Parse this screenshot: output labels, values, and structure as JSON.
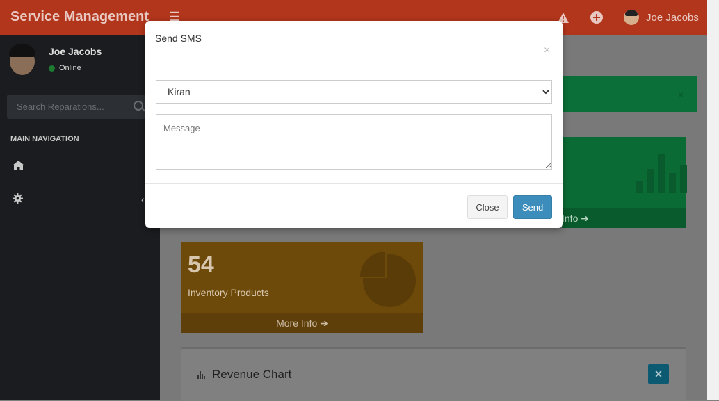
{
  "header": {
    "brand": "Service Management",
    "user_name": "Joe Jacobs",
    "icons": [
      "bars-icon",
      "warning-icon",
      "plus-circle-icon",
      "avatar"
    ]
  },
  "sidebar": {
    "user_name": "Joe Jacobs",
    "status": "Online",
    "search_placeholder": "Search Reparations...",
    "nav_header": "MAIN NAVIGATION",
    "nav_icons": [
      "home-icon",
      "gear-icon"
    ]
  },
  "dashboard": {
    "green_box_footer": "Info",
    "inventory": {
      "count": "54",
      "label": "Inventory Products",
      "footer": "More Info"
    },
    "revenue_card_title": "Revenue Chart"
  },
  "modal": {
    "title": "Send SMS",
    "close_icon": "×",
    "recipient_selected": "Kiran",
    "message_placeholder": "Message",
    "close_button": "Close",
    "send_button": "Send"
  },
  "colors": {
    "header": "#b2361c",
    "sidebar": "#1a1c1f",
    "green_box": "#0b6b35",
    "orange_box": "#6e4a0a",
    "primary_button": "#3c8dbc"
  }
}
